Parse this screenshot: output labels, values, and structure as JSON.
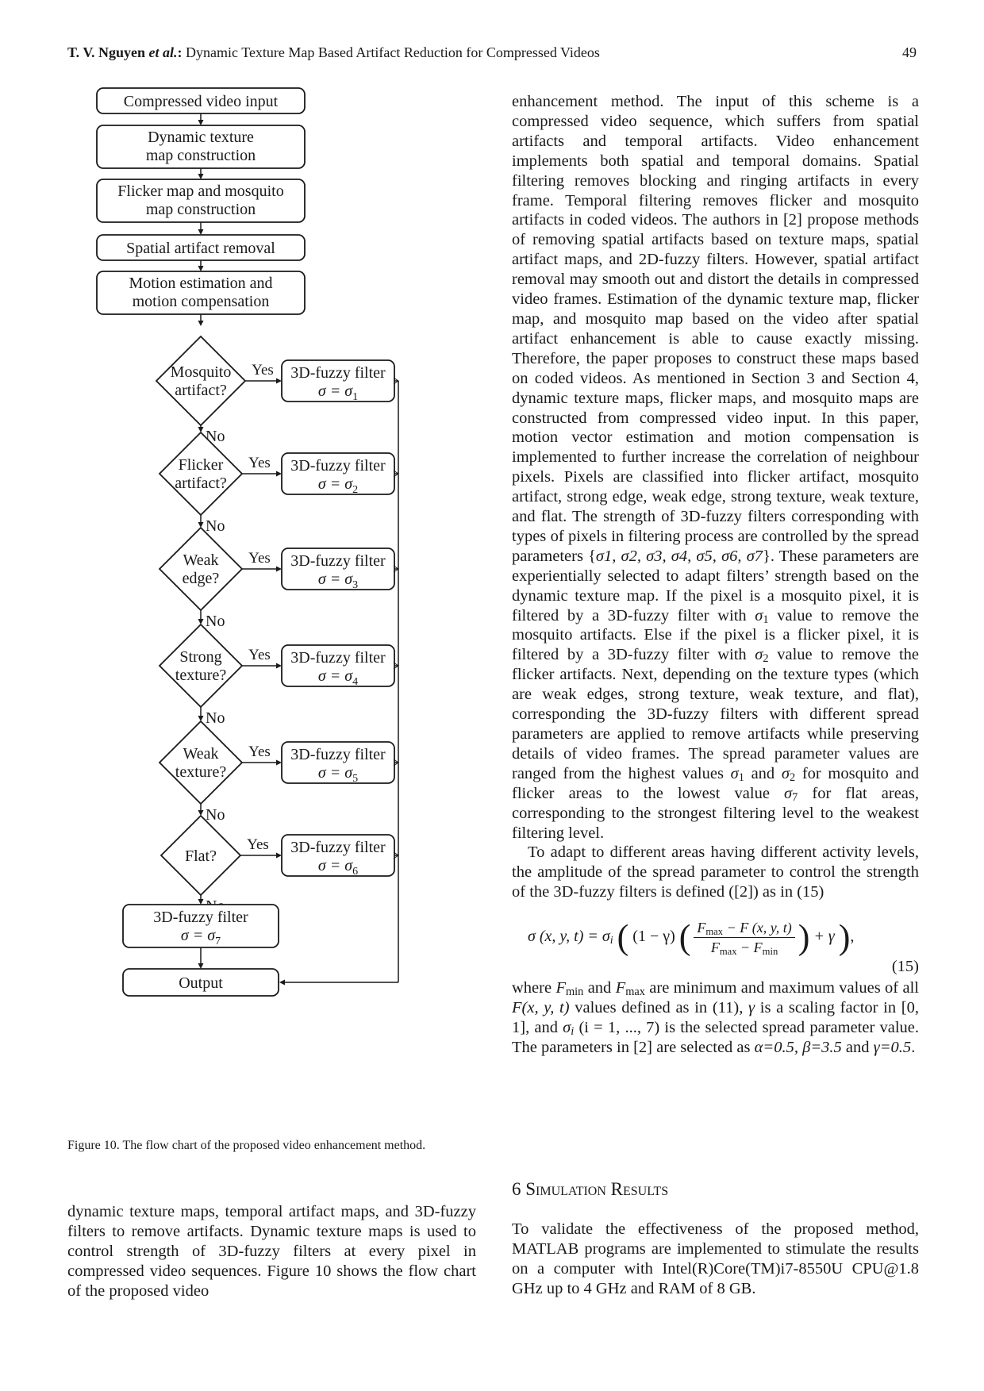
{
  "header": {
    "authors": "T. V. Nguyen",
    "et_al": "et al.",
    "title_sep": ":",
    "title": " Dynamic Texture Map Based Artifact Reduction for Compressed Videos",
    "page_number": "49"
  },
  "figure": {
    "process_boxes": [
      {
        "id": "input",
        "lines": [
          "Compressed video input"
        ]
      },
      {
        "id": "dtm",
        "lines": [
          "Dynamic texture",
          "map construction"
        ]
      },
      {
        "id": "fmm",
        "lines": [
          "Flicker map and mosquito",
          "map construction"
        ]
      },
      {
        "id": "sar",
        "lines": [
          "Spatial artifact removal"
        ]
      },
      {
        "id": "me",
        "lines": [
          "Motion estimation and",
          "motion compensation"
        ]
      }
    ],
    "decisions": [
      {
        "lines": [
          "Mosquito",
          "artifact?"
        ],
        "yes": "Yes",
        "no": "No",
        "filter_title": "3D-fuzzy filter",
        "filter_eq": "σ  =  σ",
        "sub": "1"
      },
      {
        "lines": [
          "Flicker",
          "artifact?"
        ],
        "yes": "Yes",
        "no": "No",
        "filter_title": "3D-fuzzy filter",
        "filter_eq": "σ  =  σ",
        "sub": "2"
      },
      {
        "lines": [
          "Weak",
          "edge?"
        ],
        "yes": "Yes",
        "no": "No",
        "filter_title": "3D-fuzzy filter",
        "filter_eq": "σ  =  σ",
        "sub": "3"
      },
      {
        "lines": [
          "Strong",
          "texture?"
        ],
        "yes": "Yes",
        "no": "No",
        "filter_title": "3D-fuzzy filter",
        "filter_eq": "σ  =  σ",
        "sub": "4"
      },
      {
        "lines": [
          "Weak",
          "texture?"
        ],
        "yes": "Yes",
        "no": "No",
        "filter_title": "3D-fuzzy filter",
        "filter_eq": "σ  =  σ",
        "sub": "5"
      },
      {
        "lines": [
          "Flat?"
        ],
        "yes": "Yes",
        "no": "No",
        "filter_title": "3D-fuzzy filter",
        "filter_eq": "σ  =  σ",
        "sub": "6"
      }
    ],
    "final_filter": {
      "title": "3D-fuzzy filter",
      "eq": "σ  =  σ",
      "sub": "7"
    },
    "output": "Output",
    "caption": "Figure 10. The flow chart of the proposed video enhancement method."
  },
  "left_column": {
    "paragraph": "dynamic texture maps, temporal artifact maps, and 3D-fuzzy filters to remove artifacts. Dynamic texture maps is used to control strength of 3D-fuzzy filters at every pixel in compressed video sequences. Figure 10 shows the flow chart of the proposed video"
  },
  "right_column": {
    "p1_a": "enhancement method. The input of this scheme is a compressed video sequence, which suffers from spatial artifacts and temporal artifacts. Video enhancement implements both spatial and temporal domains. Spatial filtering removes blocking and ringing artifacts in every frame. Temporal filtering removes flicker and mosquito artifacts in coded videos. The authors in [2] propose methods of removing spatial artifacts based on texture maps, spatial artifact maps, and 2D-fuzzy filters. However, spatial artifact removal may smooth out and distort the details in compressed video frames. Estimation of the dynamic texture map, flicker map, and mosquito map based on the video after spatial artifact enhancement is able to cause exactly missing. Therefore, the paper proposes to construct these maps based on coded videos. As mentioned in Section 3 and Section 4, dynamic texture maps, flicker maps, and mosquito maps are constructed from compressed video input. In this paper, motion vector estimation and motion compensation is implemented to further increase the correlation of neighbour pixels. Pixels are classified into flicker artifact, mosquito artifact, strong edge, weak edge, strong texture, weak texture, and flat. The strength of 3D-fuzzy filters corresponding with types of pixels in filtering process are controlled by the spread parameters {",
    "sigma_set": "σ1, σ2, σ3, σ4, σ5, σ6, σ7",
    "p1_b": "}. These parameters are experientially selected to adapt filters’ strength based on the dynamic texture map. If the pixel is a mosquito pixel, it is filtered by a 3D-fuzzy filter with ",
    "p1_c": " value to remove the mosquito artifacts. Else if the pixel is a flicker pixel, it is filtered by a 3D-fuzzy filter with ",
    "p1_d": " value to remove the flicker artifacts. Next, depending on the texture types (which are weak edges, strong texture, weak texture, and flat), corresponding the 3D-fuzzy filters with different spread parameters are applied to remove artifacts while preserving details of video frames. The spread parameter values are ranged from the highest values ",
    "p1_e": " and ",
    "p1_f": " for mosquito and flicker areas to the lowest value ",
    "p1_g": " for flat areas, corresponding to the strongest filtering level to the weakest filtering level.",
    "p2": "To adapt to different areas having different activity levels, the amplitude of the spread parameter to control the strength of the 3D-fuzzy filters is defined ([2]) as in (15)",
    "equation": {
      "lhs": "σ (x, y, t) = σ",
      "lhs_sub": "i",
      "mid": "(1 − γ)",
      "num": "F",
      "num_sub": "max",
      "num_rest": " − F (x, y, t)",
      "den": "F",
      "den_sub1": "max",
      "den_mid": " − F",
      "den_sub2": "min",
      "tail": "+ γ",
      "number": "(15)"
    },
    "p3_a": "where ",
    "p3_b": " and ",
    "p3_c": " are minimum and maximum values of all ",
    "p3_fxyt": "F(x, y, t)",
    "p3_d": " values defined as in (11), ",
    "p3_e": " is a scaling factor in [0, 1], and ",
    "p3_f": " (i = 1, ..., 7) is the selected spread parameter value. The parameters in [2] are selected as ",
    "p3_g": "α=0.5, β=3.5",
    "p3_h": " and ",
    "p3_i": "γ=0.5",
    "p3_j": "."
  },
  "section": {
    "number": "6",
    "title": "Simulation Results",
    "paragraph": "To validate the effectiveness of the proposed method, MATLAB programs are implemented to stimulate the results on a computer with Intel(R)Core(TM)i7-8550U CPU@1.8 GHz up to 4 GHz and RAM of 8 GB."
  }
}
